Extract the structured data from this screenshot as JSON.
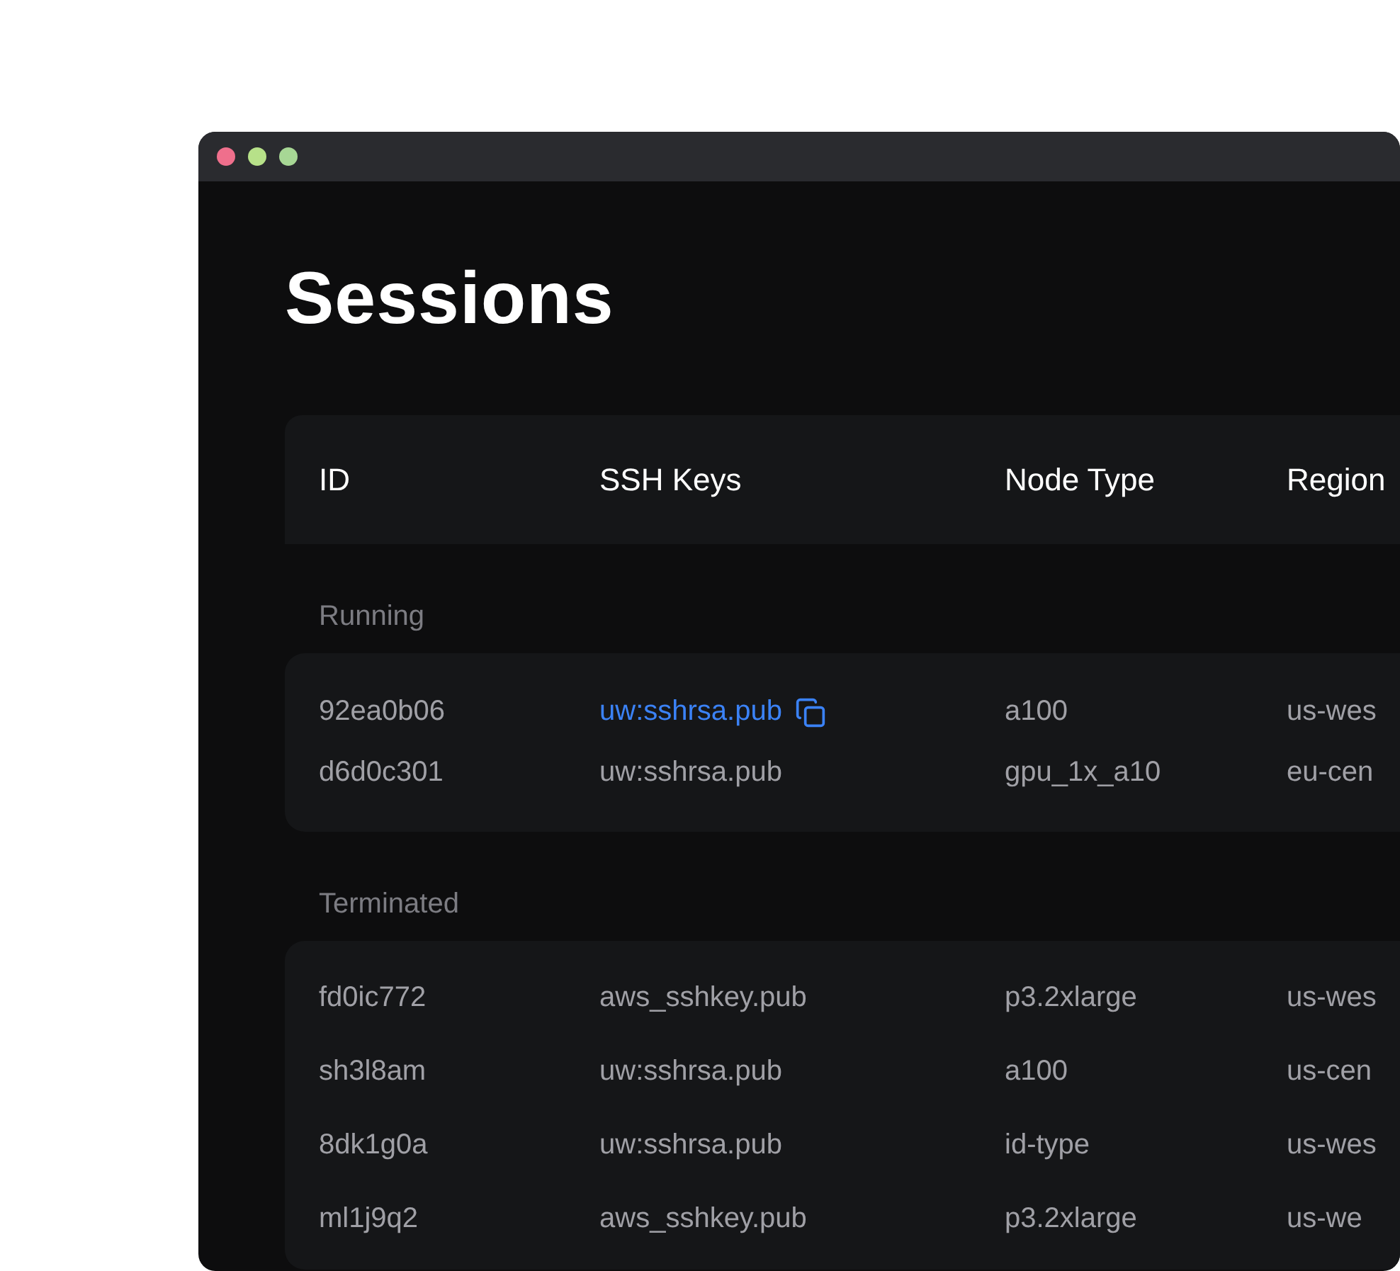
{
  "window": {
    "controls": [
      {
        "color": "#ef6f8c"
      },
      {
        "color": "#b7e189"
      },
      {
        "color": "#a7d795"
      }
    ]
  },
  "title": "Sessions",
  "table": {
    "columns": [
      "ID",
      "SSH Keys",
      "Node Type",
      "Region"
    ],
    "groups": [
      {
        "label": "Running",
        "rows": [
          {
            "id": "92ea0b06",
            "ssh_key": "uw:sshrsa.pub",
            "linked": true,
            "node_type": "a100",
            "region": "us-wes"
          },
          {
            "id": "d6d0c301",
            "ssh_key": "uw:sshrsa.pub",
            "linked": false,
            "node_type": "gpu_1x_a10",
            "region": "eu-cen"
          }
        ]
      },
      {
        "label": "Terminated",
        "rows": [
          {
            "id": "fd0ic772",
            "ssh_key": "aws_sshkey.pub",
            "linked": false,
            "node_type": "p3.2xlarge",
            "region": "us-wes"
          },
          {
            "id": "sh3l8am",
            "ssh_key": "uw:sshrsa.pub",
            "linked": false,
            "node_type": "a100",
            "region": "us-cen"
          },
          {
            "id": "8dk1g0a",
            "ssh_key": "uw:sshrsa.pub",
            "linked": false,
            "node_type": "id-type",
            "region": "us-wes"
          },
          {
            "id": "ml1j9q2",
            "ssh_key": "aws_sshkey.pub",
            "linked": false,
            "node_type": "p3.2xlarge",
            "region": "us-we"
          }
        ]
      }
    ]
  }
}
